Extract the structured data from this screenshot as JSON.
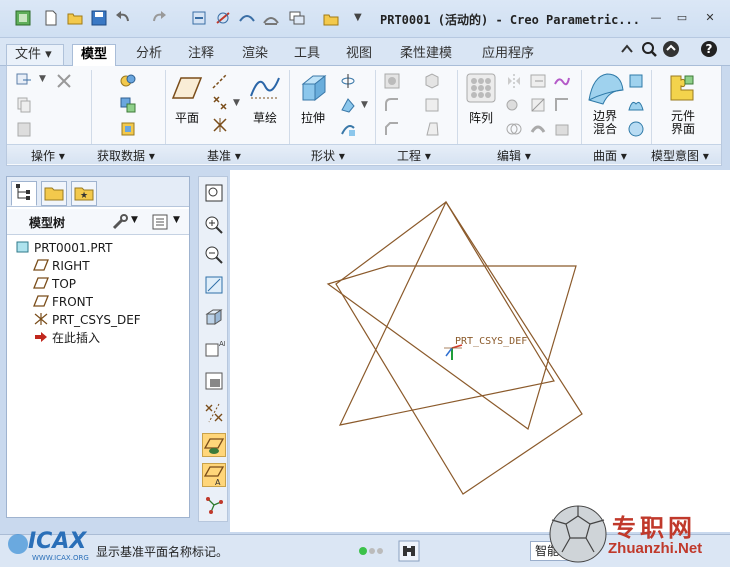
{
  "window": {
    "title": "PRT0001 (活动的) - Creo Parametric...",
    "controls": [
      "minimize",
      "maximize",
      "close"
    ]
  },
  "quick_access": {
    "icons": [
      "app-icon",
      "new-icon",
      "open-icon",
      "save-icon",
      "undo-icon",
      "redo-icon",
      "regenerate-icon",
      "windows-icon",
      "close-window-icon",
      "customize-icon"
    ]
  },
  "tabs": {
    "file": "文件",
    "items": [
      "模型",
      "分析",
      "注释",
      "渲染",
      "工具",
      "视图",
      "柔性建模",
      "应用程序"
    ],
    "active": "模型"
  },
  "ribbon": {
    "groups": {
      "operations": "操作",
      "get_data": "获取数据",
      "datum": "基准",
      "shapes": "形状",
      "engineering": "工程",
      "editing": "编辑",
      "surfaces": "曲面",
      "model_intent": "模型意图"
    },
    "buttons": {
      "plane": "平面",
      "sketch": "草绘",
      "extrude": "拉伸",
      "pattern": "阵列",
      "boundary_blend_1": "边界",
      "boundary_blend_2": "混合",
      "component_interface_1": "元件",
      "component_interface_2": "界面"
    }
  },
  "model_tree": {
    "header": "模型树",
    "items": [
      "PRT0001.PRT",
      "RIGHT",
      "TOP",
      "FRONT",
      "PRT_CSYS_DEF",
      "在此插入"
    ]
  },
  "canvas": {
    "csys_label": "PRT_CSYS_DEF"
  },
  "status": {
    "message": "显示基准平面名称标记。",
    "filter": "智能"
  },
  "watermarks": {
    "left": "ICAX",
    "left_sub": "WWW.ICAX.ORG",
    "right_1": "专职网",
    "right_2": "Zhuanzhi.Net"
  },
  "colors": {
    "datum_plane": "#8b5a2b",
    "ribbon_bg": "#f7f9fc",
    "frame_bg": "#c9d9ee"
  }
}
